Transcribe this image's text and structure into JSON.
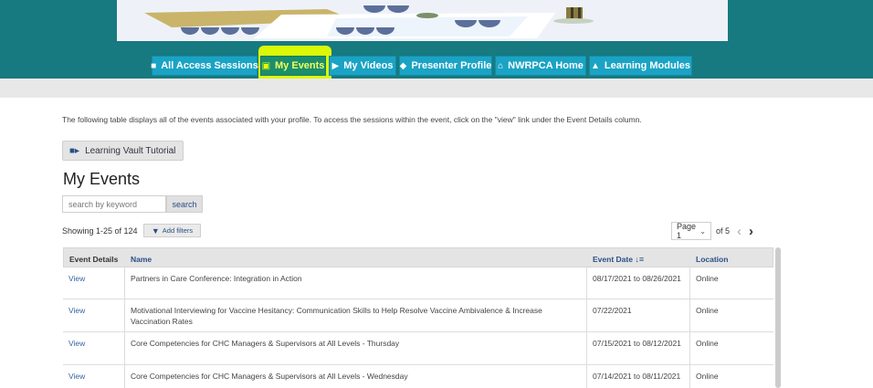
{
  "nav": {
    "items": [
      {
        "label": "All Access Sessions",
        "icon": "grid-icon"
      },
      {
        "label": "My Events",
        "icon": "briefcase-icon"
      },
      {
        "label": "My Videos",
        "icon": "video-camera-icon"
      },
      {
        "label": "Presenter Profile",
        "icon": "diamond-icon"
      },
      {
        "label": "NWRPCA Home",
        "icon": "home-icon"
      },
      {
        "label": "Learning Modules",
        "icon": "graduation-cap-icon"
      }
    ],
    "highlighted": "My Events"
  },
  "intro_text": "The following table displays all of the events associated with your profile. To access the sessions within the event, click on the \"view\" link under the Event Details column.",
  "tutorial_button": "Learning Vault Tutorial",
  "page_title": "My Events",
  "search": {
    "placeholder": "search by keyword",
    "button": "search"
  },
  "showing": "Showing 1-25 of 124",
  "filters_button": "Add filters",
  "pager": {
    "page_label": "Page 1",
    "of_label": "of 5"
  },
  "table": {
    "headers": {
      "details": "Event Details",
      "name": "Name",
      "date": "Event Date",
      "location": "Location"
    },
    "rows": [
      {
        "details": "View",
        "name": "Partners in Care Conference: Integration in Action",
        "date": "08/17/2021 to 08/26/2021",
        "location": "Online"
      },
      {
        "details": "View",
        "name": "Motivational Interviewing for Vaccine Hesitancy: Communication Skills to Help Resolve Vaccine Ambivalence & Increase Vaccination Rates",
        "date": "07/22/2021",
        "location": "Online"
      },
      {
        "details": "View",
        "name": "Core Competencies for CHC Managers & Supervisors at All Levels - Thursday",
        "date": "07/15/2021 to 08/12/2021",
        "location": "Online"
      },
      {
        "details": "View",
        "name": "Core Competencies for CHC Managers & Supervisors at All Levels - Wednesday",
        "date": "07/14/2021 to 08/11/2021",
        "location": "Online"
      }
    ]
  },
  "colors": {
    "header_bg": "#177a80",
    "nav_btn": "#1aa3c4",
    "highlight": "#e6ff00",
    "link": "#3465a4"
  }
}
